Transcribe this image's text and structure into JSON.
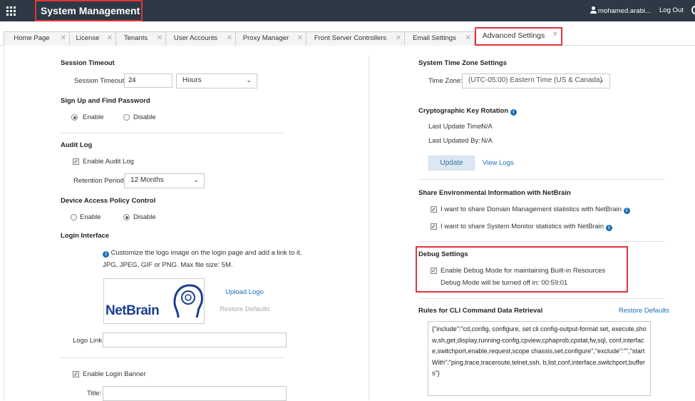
{
  "header": {
    "app_title": "System Management",
    "user": "mohamed.arabi...",
    "logout": "Log Out"
  },
  "tabs": [
    {
      "label": "Home Page"
    },
    {
      "label": "License"
    },
    {
      "label": "Tenants"
    },
    {
      "label": "User Accounts"
    },
    {
      "label": "Proxy Manager"
    },
    {
      "label": "Front Server Controllers"
    },
    {
      "label": "Email Settings"
    },
    {
      "label": "Advanced Settings"
    }
  ],
  "left": {
    "session": {
      "title": "Session Timeout",
      "label": "Session Timeout:",
      "value": "24",
      "unit": "Hours"
    },
    "signup": {
      "title": "Sign Up and Find Password",
      "enable": "Enable",
      "disable": "Disable"
    },
    "audit": {
      "title": "Audit Log",
      "enable_label": "Enable Audit Log",
      "retention_label": "Retention Period:",
      "retention_value": "12 Months"
    },
    "device": {
      "title": "Device Access Policy Control",
      "enable": "Enable",
      "disable": "Disable"
    },
    "login": {
      "title": "Login Interface",
      "hint1": "Customize the logo image on the login page and add a link to it.",
      "hint2": "JPG, JPEG, GIF or PNG. Max file size: 5M.",
      "logo_text_net": "Net",
      "logo_text_brain": "Brain",
      "upload": "Upload Logo",
      "restore": "Restore Defaults",
      "logo_link_label": "Logo Link:",
      "banner_label": "Enable Login Banner",
      "title_label": "Title:"
    }
  },
  "right": {
    "timezone": {
      "title": "System Time Zone Settings",
      "label": "Time Zone:",
      "value": "(UTC-05:00) Eastern Time (US & Canada)"
    },
    "crypto": {
      "title": "Cryptographic Key Rotation",
      "last_update": "Last Update Time:",
      "last_update_value": "N/A",
      "updated_by": "Last Updated By:",
      "updated_by_value": "N/A",
      "update_button": "Update",
      "view_logs": "View Logs"
    },
    "share": {
      "title": "Share Environmental Information with NetBrain",
      "opt1": "I want to share Domain Management statistics with NetBrain",
      "opt2": "I want to share System Monitor statistics with NetBrain"
    },
    "debug": {
      "title": "Debug Settings",
      "enable_label": "Enable Debug Mode for maintaining Built-in Resources",
      "countdown": "Debug Mode will be turned off in: 00:59:01"
    },
    "cli": {
      "title": "Rules for CLI Command Data Retrieval",
      "restore": "Restore Defaults",
      "text": "{\"include\":\"cd,config, configure, set cli config-output-format set, execute,show,sh,get,display,running-config,cpview,cphaprob,cpstat,fw,sql, conf,interface,switchport,enable,request,scope chassis,set,configure\",\"exclude\":\"\",\"startWith\":\"ping,trace,traceroute,telnet,ssh, b,list,conf,interface,switchport,buffers\"}"
    }
  },
  "icons": {
    "apps": "apps-grid-icon",
    "user": "user-icon",
    "info": "info-icon",
    "chevron": "chevron-down-icon",
    "close": "close-icon"
  },
  "colors": {
    "topbar": "#2d3a46",
    "highlight": "#e0343a",
    "link": "#1b6fb5",
    "logo": "#1c3f8f"
  }
}
